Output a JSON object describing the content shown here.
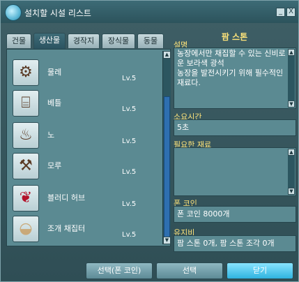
{
  "window": {
    "title": "설치할 시설 리스트",
    "buttons": {
      "minimize": "_",
      "close": "X"
    }
  },
  "tabs": [
    {
      "label": "건물",
      "active": false
    },
    {
      "label": "생산물",
      "active": true
    },
    {
      "label": "경작지",
      "active": false
    },
    {
      "label": "장식물",
      "active": false
    },
    {
      "label": "동물",
      "active": false
    }
  ],
  "items": [
    {
      "name": "물레",
      "level": "Lv.5",
      "icon": "spinning-wheel-icon",
      "glyph": "⚙"
    },
    {
      "name": "베틀",
      "level": "Lv.5",
      "icon": "loom-icon",
      "glyph": "⌸"
    },
    {
      "name": "노",
      "level": "Lv.5",
      "icon": "furnace-icon",
      "glyph": "♨"
    },
    {
      "name": "모루",
      "level": "Lv.5",
      "icon": "anvil-icon",
      "glyph": "⚒"
    },
    {
      "name": "블러디 허브",
      "level": "Lv.5",
      "icon": "bloody-herb-icon",
      "glyph": "❦"
    },
    {
      "name": "조개 채집터",
      "level": "Lv.5",
      "icon": "shell-icon",
      "glyph": "◒"
    }
  ],
  "detail": {
    "name": "팜 스톤",
    "description_label": "설명",
    "description": "농장에서만 채집할 수 있는 신비로\n운 보라색 광석\n농장을 발전시키기 위해 필수적인\n재료다.",
    "time_label": "소요시간",
    "time": "5초",
    "materials_label": "필요한 재료",
    "materials": "",
    "coin_label": "폰 코인",
    "coin": "폰 코인 8000개",
    "maintenance_label": "유지비",
    "maintenance": "팜 스톤 0개, 팜 스톤 조각 0개"
  },
  "buttons": {
    "select_coin": "선택(폰 코인)",
    "select": "선택",
    "close": "닫기"
  },
  "colors": {
    "accent": "#ffe47a",
    "primary_button": "#2fb3e0",
    "panel": "#5b8a92"
  }
}
